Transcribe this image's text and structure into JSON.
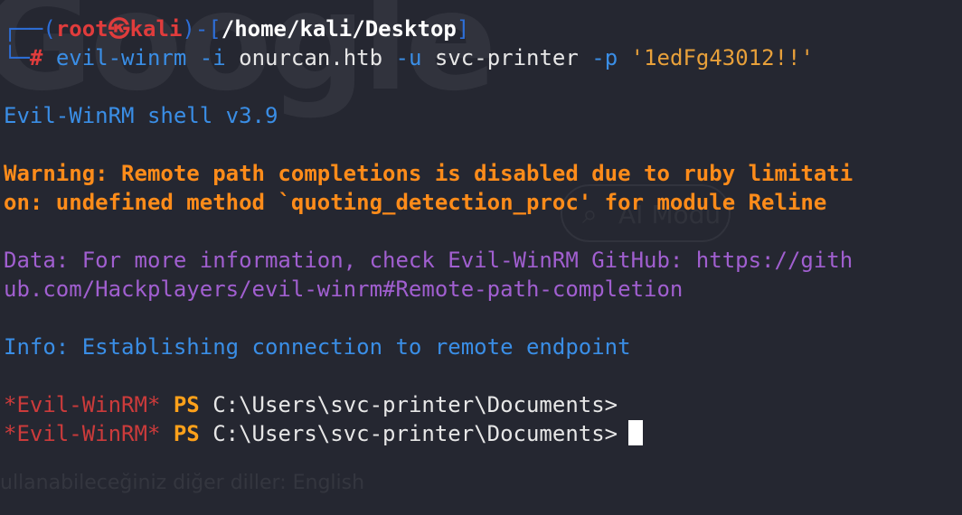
{
  "prompt": {
    "frame_open": "┌──(",
    "user": "root",
    "at_symbol": "㉿",
    "host": "kali",
    "separator": ")-[",
    "cwd": "/home/kali/Desktop",
    "frame_close": "]",
    "frame_bottom": "└─",
    "hash": "#"
  },
  "command": {
    "program": "evil-winrm",
    "flag_i": "-i",
    "host_value": "onurcan.htb",
    "flag_u": "-u",
    "user_value": "svc-printer",
    "flag_p": "-p",
    "password": "'1edFg43012!!'"
  },
  "output": {
    "shell_version": "Evil-WinRM shell v3.9",
    "warning_line1": "Warning: Remote path completions is disabled due to ruby limitati",
    "warning_line2": "on: undefined method `quoting_detection_proc' for module Reline",
    "data_line1": "Data: For more information, check Evil-WinRM GitHub: https://gith",
    "data_line2": "ub.com/Hackplayers/evil-winrm#Remote-path-completion",
    "info": "Info: Establishing connection to remote endpoint"
  },
  "ps_lines": [
    {
      "tag": "*Evil-WinRM*",
      "ps": "PS",
      "path": "C:\\Users\\svc-printer\\Documents>"
    },
    {
      "tag": "*Evil-WinRM*",
      "ps": "PS",
      "path": "C:\\Users\\svc-printer\\Documents>"
    }
  ],
  "background_overlay": {
    "logo_text": "Google",
    "ai_button": "AI Modu",
    "bottom_text": "ullanabileceğiniz diğer diller: English"
  },
  "colors": {
    "background": "#252731",
    "frame_blue": "#2d6fd9",
    "prompt_red": "#e03c3c",
    "info_blue": "#3a8ee6",
    "warning_orange": "#ff8c1a",
    "data_purple": "#a15fd0",
    "string_orange": "#e8a03a"
  }
}
